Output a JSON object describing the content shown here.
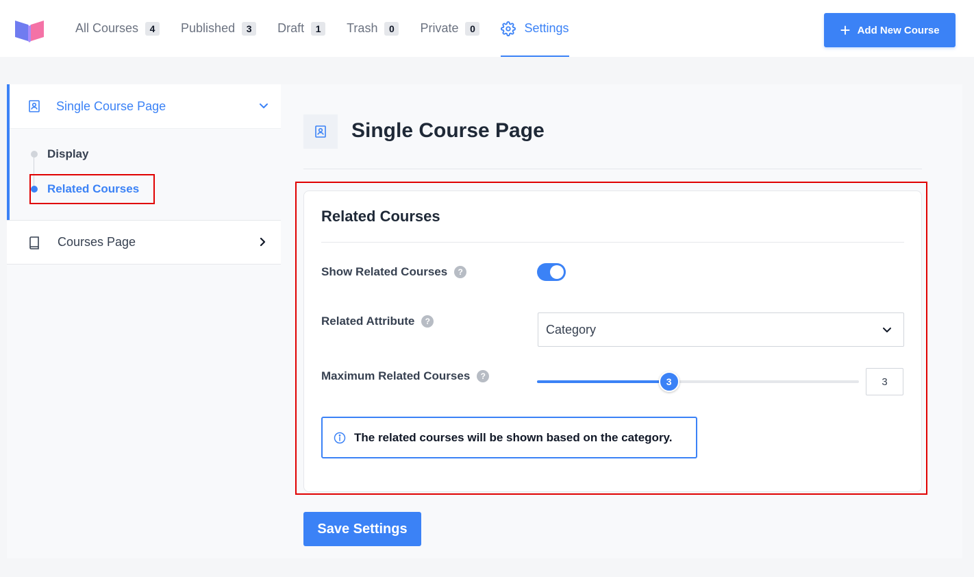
{
  "nav": {
    "tabs": [
      {
        "label": "All Courses",
        "count": "4"
      },
      {
        "label": "Published",
        "count": "3"
      },
      {
        "label": "Draft",
        "count": "1"
      },
      {
        "label": "Trash",
        "count": "0"
      },
      {
        "label": "Private",
        "count": "0"
      }
    ],
    "settings_label": "Settings",
    "add_button_label": "Add New Course"
  },
  "sidebar": {
    "section_active": "Single Course Page",
    "sub_items": [
      {
        "label": "Display"
      },
      {
        "label": "Related Courses"
      }
    ],
    "section_other": "Courses Page"
  },
  "main": {
    "page_title": "Single Course Page",
    "card_title": "Related Courses",
    "show_related_label": "Show Related Courses",
    "show_related_enabled": true,
    "related_attribute_label": "Related Attribute",
    "related_attribute_value": "Category",
    "max_related_label": "Maximum Related Courses",
    "max_related_value": "3",
    "max_related_slider_fraction": 0.41,
    "help_glyph": "?",
    "notice_text": "The related courses will be shown based on the category.",
    "save_label": "Save Settings"
  },
  "colors": {
    "accent": "#3b82f6",
    "highlight": "#e00000"
  }
}
